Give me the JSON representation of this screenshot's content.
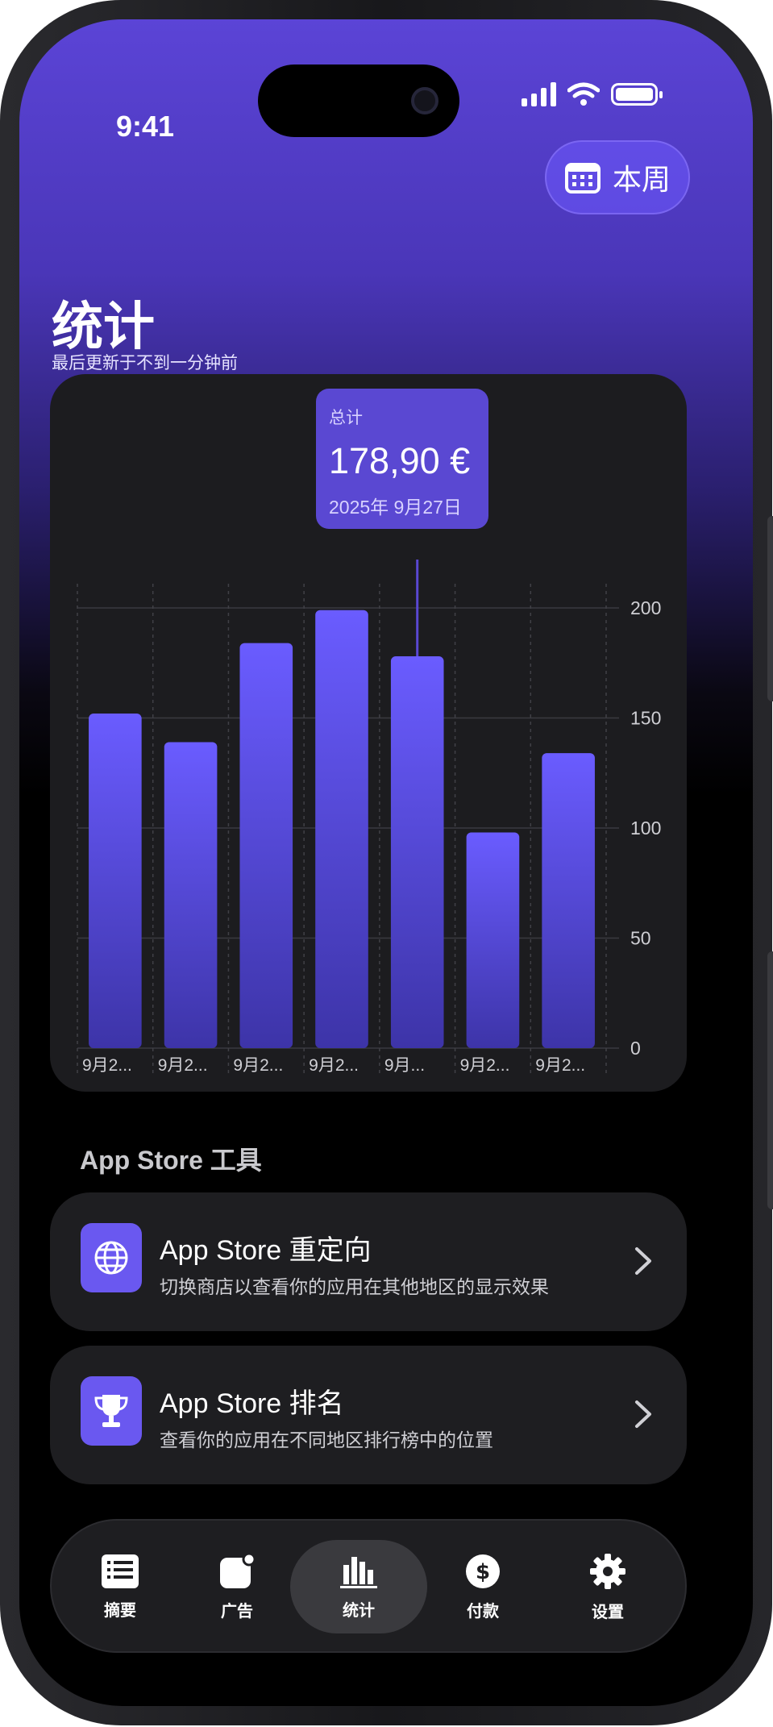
{
  "status_bar": {
    "time": "9:41"
  },
  "header": {
    "period_button": "本周",
    "title": "统计",
    "subtitle": "最后更新于不到一分钟前"
  },
  "tooltip": {
    "label": "总计",
    "value": "178,90 €",
    "date": "2025年 9月27日"
  },
  "chart_data": {
    "type": "bar",
    "categories": [
      "9月2...",
      "9月2...",
      "9月2...",
      "9月2...",
      "9月...",
      "9月2...",
      "9月2..."
    ],
    "values": [
      152,
      139,
      184,
      199,
      178,
      98,
      134
    ],
    "ylim": [
      0,
      200
    ],
    "yticks": [
      "0",
      "50",
      "100",
      "150",
      "200"
    ],
    "highlighted_index": 4,
    "grid": true,
    "bar_color": "#6a5cff"
  },
  "tools_section": {
    "title": "App Store 工具",
    "items": [
      {
        "title": "App Store 重定向",
        "desc": "切换商店以查看你的应用在其他地区的显示效果",
        "icon": "globe-icon"
      },
      {
        "title": "App Store 排名",
        "desc": "查看你的应用在不同地区排行榜中的位置",
        "icon": "trophy-icon"
      }
    ]
  },
  "tabbar": {
    "items": [
      {
        "label": "摘要",
        "icon": "list-icon"
      },
      {
        "label": "广告",
        "icon": "ads-icon"
      },
      {
        "label": "统计",
        "icon": "chart-icon",
        "active": true
      },
      {
        "label": "付款",
        "icon": "dollar-icon"
      },
      {
        "label": "设置",
        "icon": "gear-icon"
      }
    ]
  },
  "colors": {
    "accent": "#5b44d6",
    "card": "#1e1e21",
    "icon_bg": "#6a58f0"
  }
}
